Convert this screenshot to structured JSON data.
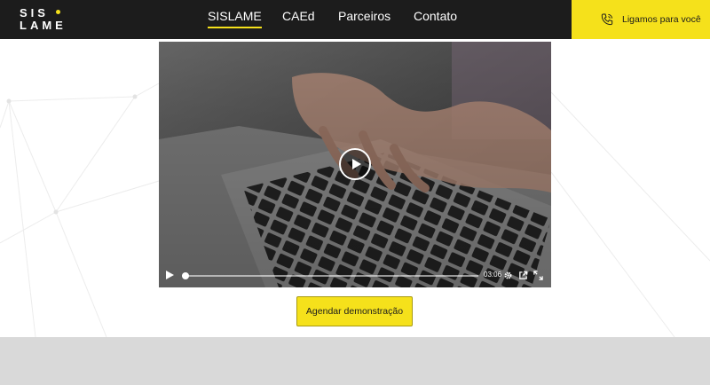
{
  "brand": {
    "logo_line1": "SIS",
    "logo_line2": "LAME",
    "accent_color": "#f5e11b",
    "header_color": "#1c1c1c"
  },
  "nav": {
    "items": [
      {
        "label": "SISLAME",
        "active": true
      },
      {
        "label": "CAEd",
        "active": false
      },
      {
        "label": "Parceiros",
        "active": false
      },
      {
        "label": "Contato",
        "active": false
      }
    ]
  },
  "callback": {
    "label": "Ligamos para você",
    "icon": "phone-icon"
  },
  "video": {
    "duration": "03:06",
    "progress": 0.0,
    "controls": [
      "play-icon",
      "settings-icon",
      "external-link-icon",
      "fullscreen-icon"
    ]
  },
  "cta": {
    "label": "Agendar demonstração"
  }
}
